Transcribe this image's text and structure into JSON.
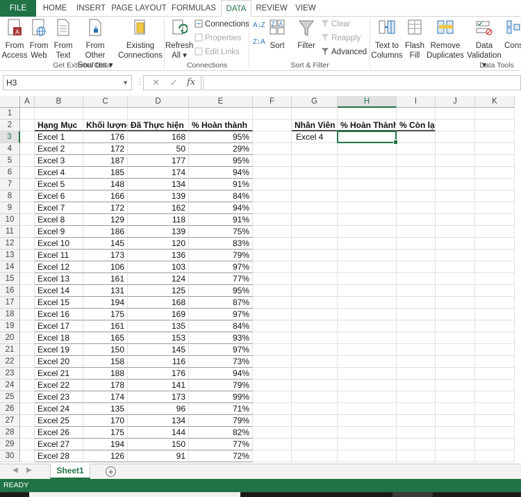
{
  "tabs": [
    "FILE",
    "HOME",
    "INSERT",
    "PAGE LAYOUT",
    "FORMULAS",
    "DATA",
    "REVIEW",
    "VIEW"
  ],
  "active_tab": "DATA",
  "ribbon": {
    "from_access": [
      "From",
      "Access"
    ],
    "from_web": [
      "From",
      "Web"
    ],
    "from_text": [
      "From",
      "Text"
    ],
    "from_other": [
      "From Other",
      "Sources ▾"
    ],
    "existing": [
      "Existing",
      "Connections"
    ],
    "refresh": [
      "Refresh",
      "All ▾"
    ],
    "connections": "Connections",
    "properties": "Properties",
    "edit_links": "Edit Links",
    "sort": "Sort",
    "filter": "Filter",
    "clear": "Clear",
    "reapply": "Reapply",
    "advanced": "Advanced",
    "text_to_columns": [
      "Text to",
      "Columns"
    ],
    "flash_fill": [
      "Flash",
      "Fill"
    ],
    "remove_duplicates": [
      "Remove",
      "Duplicates"
    ],
    "data_validation": [
      "Data",
      "Validation ▾"
    ],
    "consolidate": "Cons",
    "groups": {
      "external": "Get External Data",
      "connections": "Connections",
      "sort_filter": "Sort & Filter",
      "data_tools": "Data Tools"
    }
  },
  "formula_bar": {
    "name_box": "H3",
    "cancel": "✕",
    "enter": "✓",
    "fx": "fx",
    "formula": ""
  },
  "columns": [
    "A",
    "B",
    "C",
    "D",
    "E",
    "F",
    "G",
    "H",
    "I",
    "J",
    "K"
  ],
  "selected_column": "H",
  "selected_row": 3,
  "table": {
    "headers": [
      "Hạng Mục",
      "Khối lượng",
      "Đã Thực hiện",
      "% Hoàn thành"
    ],
    "rows": [
      [
        "Excel 1",
        "176",
        "168",
        "95%"
      ],
      [
        "Excel 2",
        "172",
        "50",
        "29%"
      ],
      [
        "Excel 3",
        "187",
        "177",
        "95%"
      ],
      [
        "Excel 4",
        "185",
        "174",
        "94%"
      ],
      [
        "Excel 5",
        "148",
        "134",
        "91%"
      ],
      [
        "Excel 6",
        "166",
        "139",
        "84%"
      ],
      [
        "Excel 7",
        "172",
        "162",
        "94%"
      ],
      [
        "Excel 8",
        "129",
        "118",
        "91%"
      ],
      [
        "Excel 9",
        "186",
        "139",
        "75%"
      ],
      [
        "Excel 10",
        "145",
        "120",
        "83%"
      ],
      [
        "Excel 11",
        "173",
        "136",
        "79%"
      ],
      [
        "Excel 12",
        "106",
        "103",
        "97%"
      ],
      [
        "Excel 13",
        "161",
        "124",
        "77%"
      ],
      [
        "Excel 14",
        "131",
        "125",
        "95%"
      ],
      [
        "Excel 15",
        "194",
        "168",
        "87%"
      ],
      [
        "Excel 16",
        "175",
        "169",
        "97%"
      ],
      [
        "Excel 17",
        "161",
        "135",
        "84%"
      ],
      [
        "Excel 18",
        "165",
        "153",
        "93%"
      ],
      [
        "Excel 19",
        "150",
        "145",
        "97%"
      ],
      [
        "Excel 20",
        "158",
        "116",
        "73%"
      ],
      [
        "Excel 21",
        "188",
        "176",
        "94%"
      ],
      [
        "Excel 22",
        "178",
        "141",
        "79%"
      ],
      [
        "Excel 23",
        "174",
        "173",
        "99%"
      ],
      [
        "Excel 24",
        "135",
        "96",
        "71%"
      ],
      [
        "Excel 25",
        "170",
        "134",
        "79%"
      ],
      [
        "Excel 26",
        "175",
        "144",
        "82%"
      ],
      [
        "Excel 27",
        "194",
        "150",
        "77%"
      ],
      [
        "Excel 28",
        "126",
        "91",
        "72%"
      ]
    ]
  },
  "lookup": {
    "headers": [
      "Nhân Viên",
      "% Hoàn Thành",
      "% Còn lại"
    ],
    "value": "Excel 4"
  },
  "row_numbers": [
    1,
    2,
    3,
    4,
    5,
    6,
    7,
    8,
    9,
    10,
    11,
    12,
    13,
    14,
    15,
    16,
    17,
    18,
    19,
    20,
    21,
    22,
    23,
    24,
    25,
    26,
    27,
    28,
    29,
    30
  ],
  "sheet_tab": "Sheet1",
  "add_sheet": "+",
  "status": "READY",
  "colors": {
    "excel_green": "#217346"
  }
}
